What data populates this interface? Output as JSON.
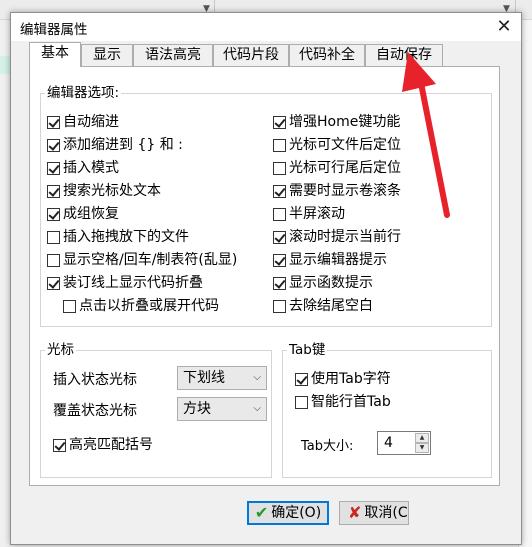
{
  "dialog": {
    "title": "编辑器属性",
    "close_glyph": "✕"
  },
  "tabs": [
    {
      "label": "基本",
      "active": true
    },
    {
      "label": "显示"
    },
    {
      "label": "语法高亮"
    },
    {
      "label": "代码片段"
    },
    {
      "label": "代码补全"
    },
    {
      "label": "自动保存"
    }
  ],
  "editor_options": {
    "title": "编辑器选项:",
    "left": [
      {
        "label": "自动缩进",
        "checked": true
      },
      {
        "label": "添加缩进到 {} 和 :",
        "checked": true
      },
      {
        "label": "插入模式",
        "checked": true
      },
      {
        "label": "搜索光标处文本",
        "checked": true
      },
      {
        "label": "成组恢复",
        "checked": true
      },
      {
        "label": "插入拖拽放下的文件",
        "checked": false
      },
      {
        "label": "显示空格/回车/制表符(乱显)",
        "checked": false
      },
      {
        "label": "装订线上显示代码折叠",
        "checked": true
      },
      {
        "label": "点击以折叠或展开代码",
        "checked": false
      }
    ],
    "right": [
      {
        "label": "增强Home键功能",
        "checked": true
      },
      {
        "label": "光标可文件后定位",
        "checked": false
      },
      {
        "label": "光标可行尾后定位",
        "checked": false
      },
      {
        "label": "需要时显示卷滚条",
        "checked": true
      },
      {
        "label": "半屏滚动",
        "checked": false
      },
      {
        "label": "滚动时提示当前行",
        "checked": true
      },
      {
        "label": "显示编辑器提示",
        "checked": true
      },
      {
        "label": "显示函数提示",
        "checked": true
      },
      {
        "label": "去除结尾空白",
        "checked": false
      }
    ]
  },
  "cursor": {
    "title": "光标",
    "insert_label": "插入状态光标",
    "insert_value": "下划线",
    "overwrite_label": "覆盖状态光标",
    "overwrite_value": "方块",
    "highlight_label": "高亮匹配括号",
    "highlight_checked": true
  },
  "tab_key": {
    "title": "Tab键",
    "use_tab_label": "使用Tab字符",
    "use_tab_checked": true,
    "smart_tab_label": "智能行首Tab",
    "smart_tab_checked": false,
    "size_label": "Tab大小:",
    "size_value": "4"
  },
  "buttons": {
    "ok": "确定(O)",
    "cancel": "取消(C"
  },
  "colors": {
    "annotation_arrow": "#e8222a",
    "default_button_border": "#0078d7"
  }
}
